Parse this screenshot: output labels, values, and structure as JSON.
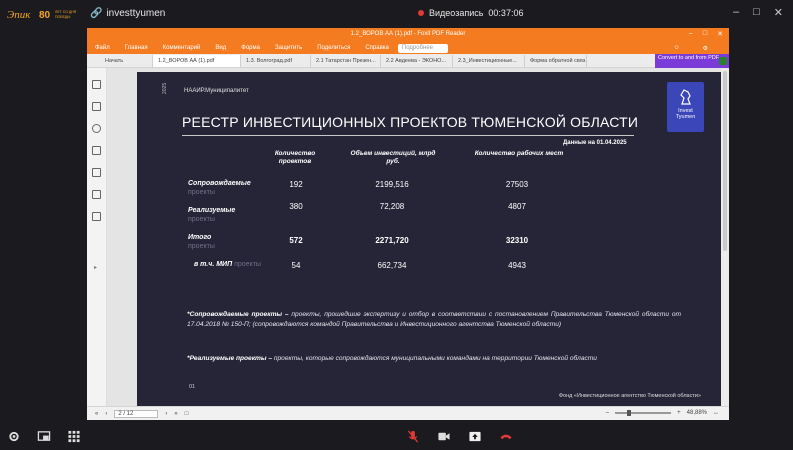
{
  "conference": {
    "logo_text": "Эпик-80 лет со дня победы",
    "room_name": "investtyumen",
    "recording_label": "Видеозапись",
    "recording_time": "00:37:06",
    "colors": {
      "background": "#1b1b1f",
      "recording": "#e53935",
      "hangup": "#e53935"
    }
  },
  "app": {
    "title": "1.2_ВОРОВ АА (1).pdf - Foxit PDF Reader",
    "menu": [
      "Файл",
      "Главная",
      "Комментарий",
      "Вид",
      "Форма",
      "Защитить",
      "Поделиться",
      "Справка"
    ],
    "search_placeholder": "Подробнее",
    "tabs": [
      "Начать",
      "1.2_ВОРОВ АА (1).pdf",
      "1.3. Волгоград.pdf",
      "2.1 Татарстан Презен...",
      "2.2 Авдеева - ЭКОНО...",
      "2.3_Инвестиционные...",
      "Форма обратной связ..."
    ],
    "convert_promo": "Convert to and from PDF",
    "accent": "#f47b20"
  },
  "slide": {
    "year": "2025",
    "org": "НААИР.Муниципалитет",
    "brand_line1": "Invest",
    "brand_line2": "Tyumen",
    "title": "РЕЕСТР ИНВЕСТИЦИОННЫХ ПРОЕКТОВ ТЮМЕНСКОЙ ОБЛАСТИ",
    "as_of": "Данные на 01.04.2025",
    "columns": [
      "Количество проектов",
      "Объем инвестиций, млрд руб.",
      "Количество рабочих мест"
    ],
    "rows": [
      {
        "label": "Сопровождаемые",
        "ghost": "проекты",
        "v1": "192",
        "v2": "2199,516",
        "v3": "27503"
      },
      {
        "label": "Реализуемые",
        "ghost": "проекты",
        "v1": "380",
        "v2": "72,208",
        "v3": "4807"
      },
      {
        "label": "Итого",
        "ghost": "проекты",
        "v1": "572",
        "v2": "2271,720",
        "v3": "32310"
      },
      {
        "label": "в т.ч. МИП",
        "ghost": "проекты",
        "v1": "54",
        "v2": "662,734",
        "v3": "4943"
      }
    ],
    "note1_term": "*Сопровождаемые проекты –",
    "note1_text": " проекты, прошедшие экспертизу и отбор в соответствии с постановлением Правительства Тюменской области от 17.04.2018 № 150-П; (сопровождаются командой Правительства и Инвестиционного агентства Тюменской области)",
    "note2_term": "*Реализуемые проекты –",
    "note2_text": " проекты, которые сопровождаются муниципальными командами на территории Тюменской области",
    "page_number": "01",
    "fund": "Фонд «Инвестиционное агентство Тюменской области»",
    "colors": {
      "background": "#262538",
      "brand": "#3b46b8"
    }
  },
  "status": {
    "page": "2 / 12",
    "zoom": "48,88%"
  }
}
